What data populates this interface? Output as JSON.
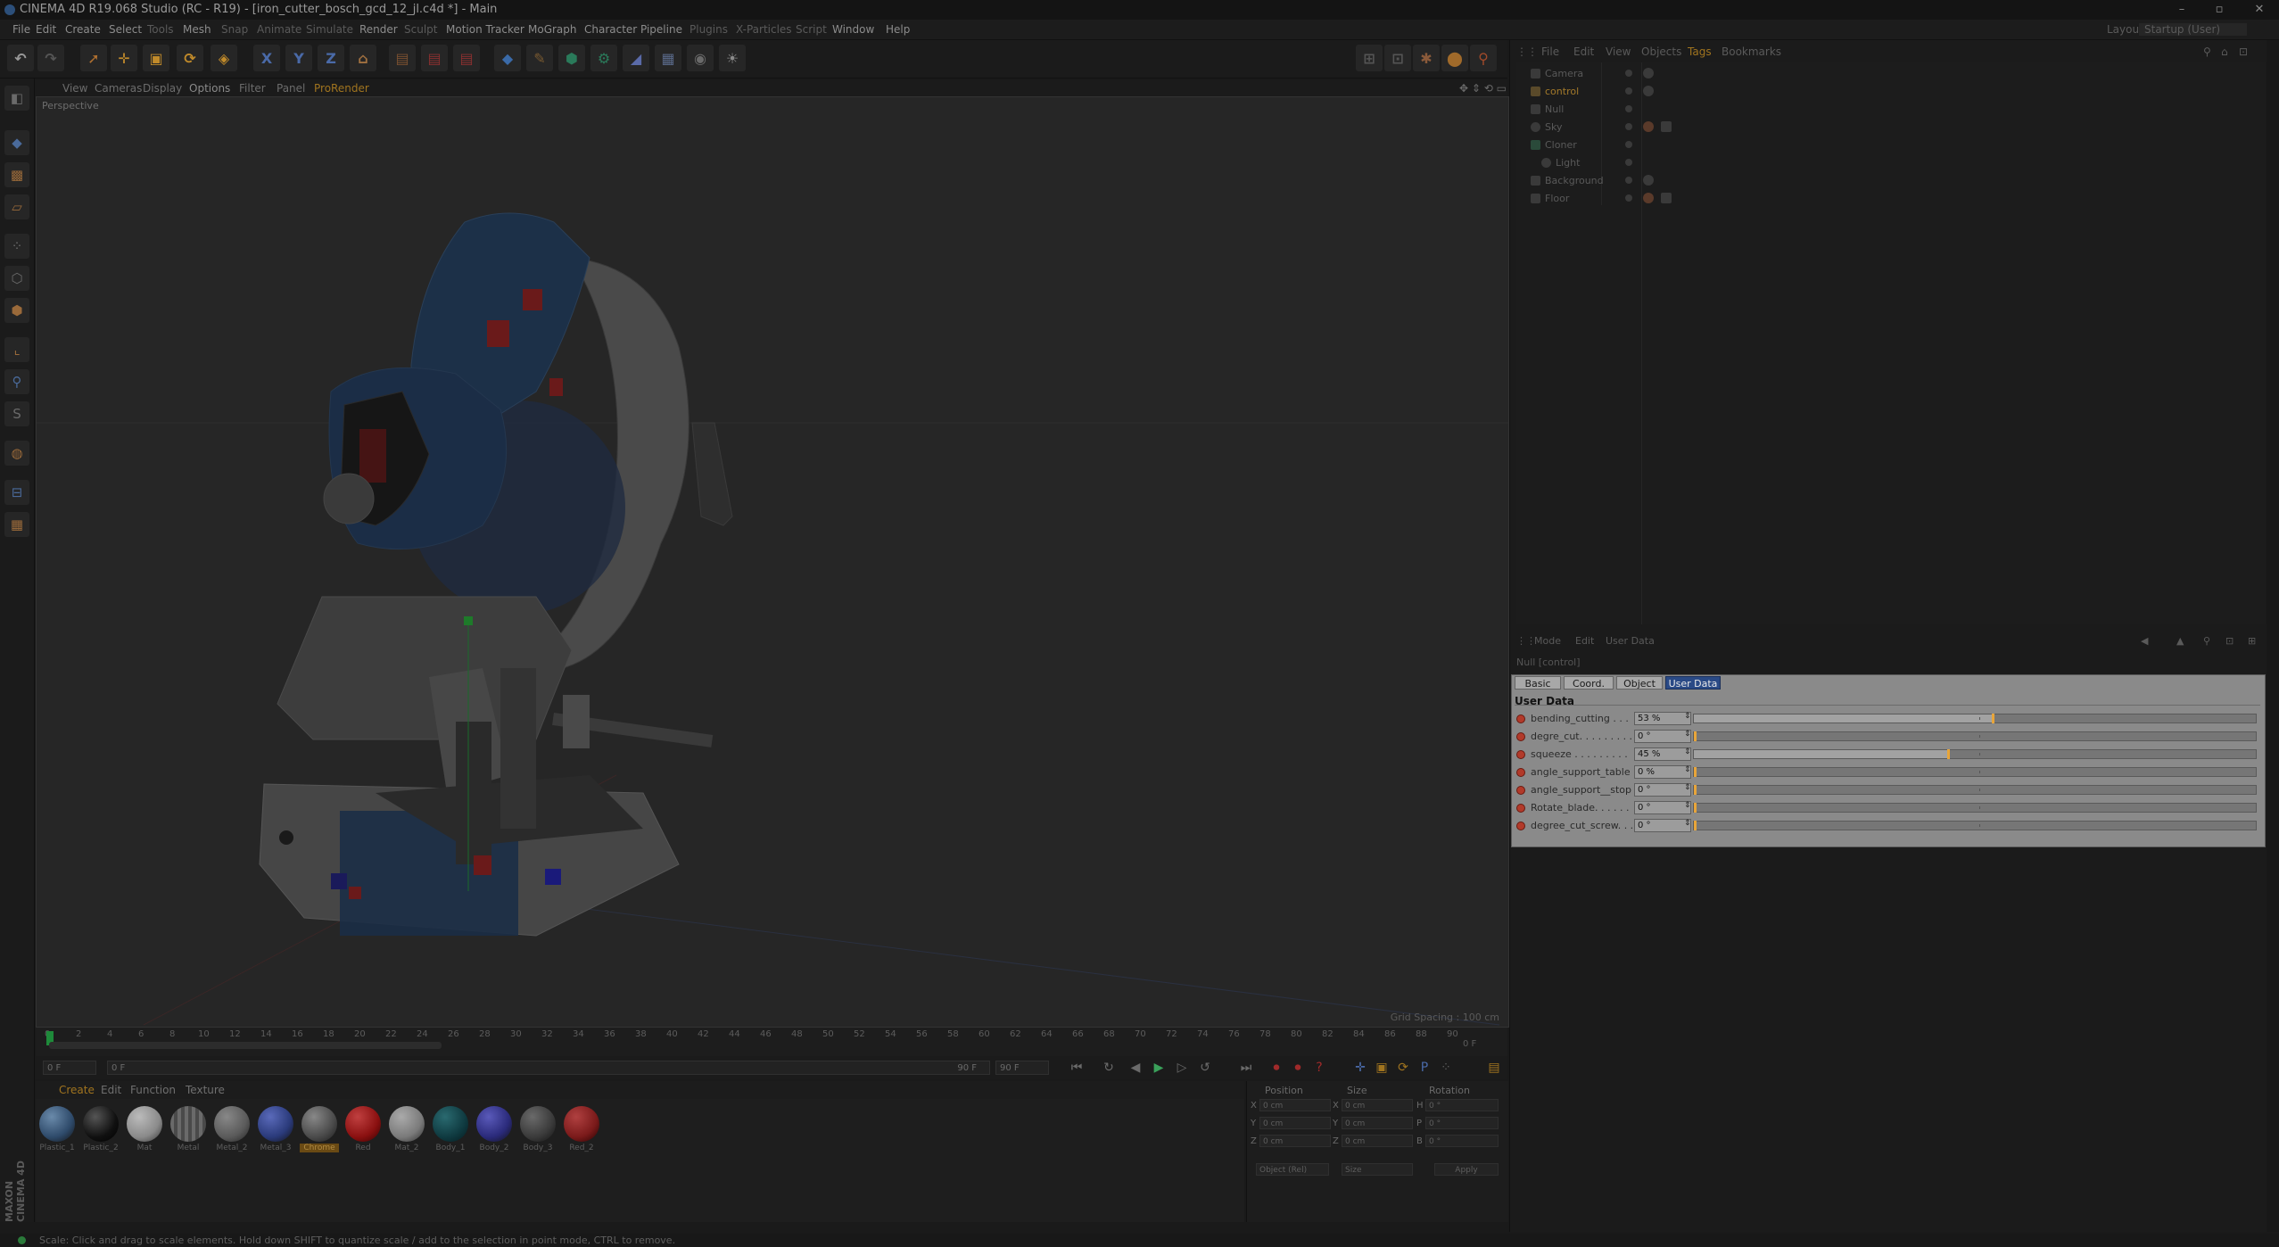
{
  "app": {
    "window_title": "CINEMA 4D R19.068 Studio (RC - R19) - [iron_cutter_bosch_gcd_12_jl.c4d *] - Main",
    "layout_label": "Layout:",
    "layout_value": "Startup (User)"
  },
  "menu": {
    "items": [
      "File",
      "Edit",
      "Create",
      "Select",
      "Tools",
      "Mesh",
      "Snap",
      "Animate",
      "Simulate",
      "Render",
      "Sculpt",
      "Motion Tracker",
      "MoGraph",
      "Character",
      "Pipeline",
      "Plugins",
      "X-Particles",
      "Script",
      "Window",
      "Help"
    ]
  },
  "toolbar": {
    "axis_x": "X",
    "axis_y": "Y",
    "axis_z": "Z"
  },
  "viewport": {
    "menu": [
      "View",
      "Cameras",
      "Display",
      "Options",
      "Filter",
      "Panel",
      "ProRender"
    ],
    "label": "Perspective",
    "grid_spacing": "Grid Spacing : 100 cm"
  },
  "timeline": {
    "ticks": [
      "0",
      "2",
      "4",
      "6",
      "8",
      "10",
      "12",
      "14",
      "16",
      "18",
      "20",
      "22",
      "24",
      "26",
      "28",
      "30",
      "32",
      "34",
      "36",
      "38",
      "40",
      "42",
      "44",
      "46",
      "48",
      "50",
      "52",
      "54",
      "56",
      "58",
      "60",
      "62",
      "64",
      "66",
      "68",
      "70",
      "72",
      "74",
      "76",
      "78",
      "80",
      "82",
      "84",
      "86",
      "88",
      "90"
    ],
    "current_frame": "0 F",
    "start_field": "0 F",
    "end_field": "90 F",
    "max_field": "90 F",
    "frame_readout": "0 F"
  },
  "materials": {
    "menu": [
      "Create",
      "Edit",
      "Function",
      "Texture"
    ],
    "items": [
      {
        "name": "Plastic_1",
        "color": "#2e4a6a"
      },
      {
        "name": "Plastic_2",
        "color": "#101010"
      },
      {
        "name": "Mat",
        "color": "#8a8a8a"
      },
      {
        "name": "Metal",
        "color": "#6a6a6a"
      },
      {
        "name": "Metal_2",
        "color": "#5a5a5a"
      },
      {
        "name": "Metal_3",
        "color": "#2a3a7a"
      },
      {
        "name": "Chrome",
        "color": "#4a4a4a",
        "selected": true
      },
      {
        "name": "Red",
        "color": "#8a1010"
      },
      {
        "name": "Mat_2",
        "color": "#7a7a7a"
      },
      {
        "name": "Body_1",
        "color": "#0f3a40"
      },
      {
        "name": "Body_2",
        "color": "#2a2a7a"
      },
      {
        "name": "Body_3",
        "color": "#3a3a3a"
      },
      {
        "name": "Red_2",
        "color": "#7a1a1a"
      }
    ]
  },
  "coords": {
    "headers": [
      "Position",
      "Size",
      "Rotation"
    ],
    "rows": [
      {
        "axis": "X",
        "pos": "0 cm",
        "size": "0 cm",
        "rot_label": "H",
        "rot": "0 °"
      },
      {
        "axis": "Y",
        "pos": "0 cm",
        "size": "0 cm",
        "rot_label": "P",
        "rot": "0 °"
      },
      {
        "axis": "Z",
        "pos": "0 cm",
        "size": "0 cm",
        "rot_label": "B",
        "rot": "0 °"
      }
    ],
    "mode": "Object (Rel)",
    "size_mode": "Size",
    "apply": "Apply"
  },
  "status": {
    "text": "Scale: Click and drag to scale elements. Hold down SHIFT to quantize scale / add to the selection in point mode, CTRL to remove."
  },
  "object_manager": {
    "menu": [
      "File",
      "Edit",
      "View",
      "Objects",
      "Tags",
      "Bookmarks"
    ],
    "objects": [
      {
        "name": "Camera",
        "indent": 0,
        "active": false
      },
      {
        "name": "control",
        "indent": 0,
        "active": true
      },
      {
        "name": "Null",
        "indent": 0,
        "active": false
      },
      {
        "name": "Sky",
        "indent": 0,
        "active": false
      },
      {
        "name": "Cloner",
        "indent": 0,
        "active": false
      },
      {
        "name": "Light",
        "indent": 1,
        "active": false
      },
      {
        "name": "Background",
        "indent": 0,
        "active": false
      },
      {
        "name": "Floor",
        "indent": 0,
        "active": false
      }
    ]
  },
  "attribute_manager": {
    "menu": [
      "Mode",
      "Edit",
      "User Data"
    ],
    "object_label": "Null [control]",
    "tabs": [
      "Basic",
      "Coord.",
      "Object",
      "User Data"
    ],
    "active_tab": "User Data",
    "section_title": "User Data",
    "params": [
      {
        "label": "bending_cutting . . .",
        "value": "53 %",
        "fraction": 0.53
      },
      {
        "label": "degre_cut. . . . . . . . .",
        "value": "0 °",
        "fraction": 0
      },
      {
        "label": "squeeze . . . . . . . . .",
        "value": "45 %",
        "fraction": 0.45
      },
      {
        "label": "angle_support_table",
        "value": "0 %",
        "fraction": 0
      },
      {
        "label": "angle_support__stop",
        "value": "0 °",
        "fraction": 0
      },
      {
        "label": "Rotate_blade. . . . . .",
        "value": "0 °",
        "fraction": 0
      },
      {
        "label": "degree_cut_screw. . .",
        "value": "0 °",
        "fraction": 0
      }
    ]
  },
  "colors": {
    "accent_orange": "#e8a53a",
    "active_tab_blue": "#2a4a86",
    "anim_red": "#b23a2a"
  }
}
